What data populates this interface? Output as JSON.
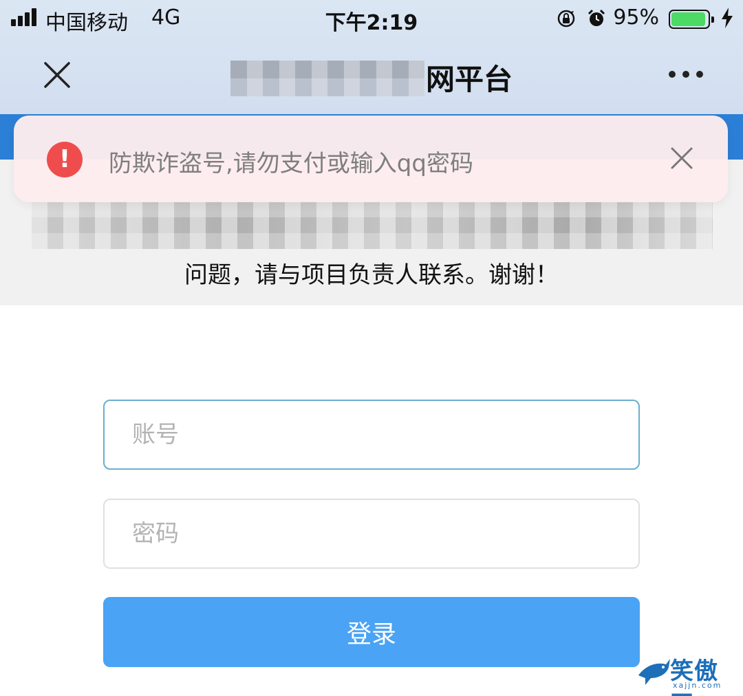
{
  "status_bar": {
    "carrier": "中国移动",
    "network": "4G",
    "time": "下午2:19",
    "battery_percent": "95%",
    "battery_level": 0.95,
    "icons": [
      "signal-bars-icon",
      "rotation-lock-icon",
      "alarm-icon",
      "battery-icon",
      "charging-bolt-icon"
    ]
  },
  "nav": {
    "title_visible": "网平台",
    "title_redacted": true,
    "close_icon": "close-icon",
    "more_icon": "more-dots-icon"
  },
  "warning_banner": {
    "icon": "exclamation-circle-icon",
    "icon_glyph": "!",
    "text": "防欺诈盗号,请勿支付或输入qq密码",
    "close_icon": "close-icon",
    "icon_color": "#ef4d4d",
    "background": "#fdecee"
  },
  "notice": {
    "redacted": true,
    "text": "问题，请与项目负责人联系。谢谢！"
  },
  "login_form": {
    "account_placeholder": "账号",
    "password_placeholder": "密码",
    "login_label": "登录",
    "button_color": "#4aa3f5"
  },
  "watermark": {
    "text": "笑傲网",
    "sub": "xajjn.com"
  }
}
